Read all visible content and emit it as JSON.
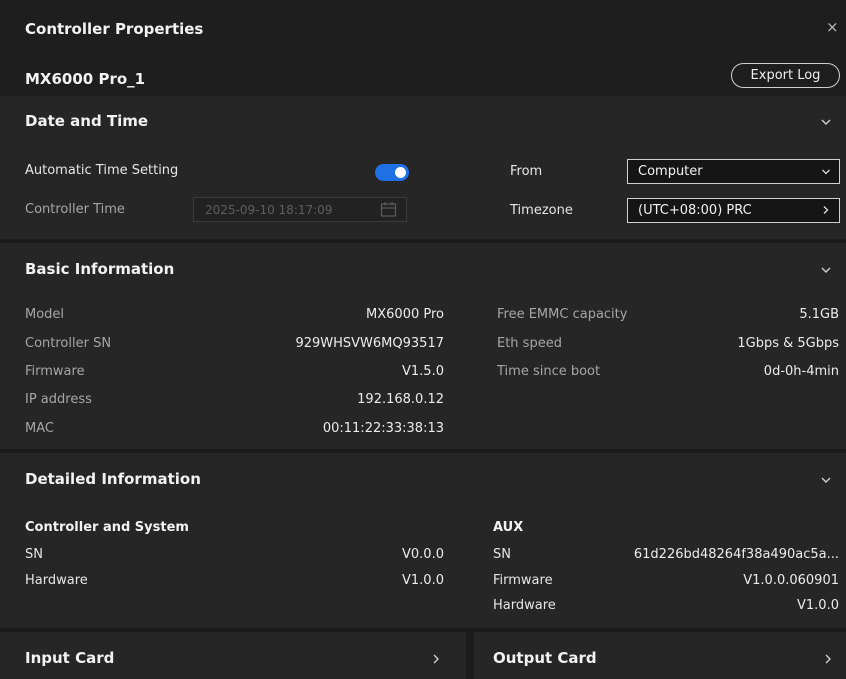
{
  "window": {
    "title": "Controller Properties",
    "close_label": "×"
  },
  "controller": {
    "name": "MX6000 Pro_1",
    "export_label": "Export Log"
  },
  "date_time": {
    "title": "Date and Time",
    "auto_label": "Automatic Time Setting",
    "auto_enabled": true,
    "time_label": "Controller Time",
    "time_value": "2025-09-10 18:17:09",
    "from_label": "From",
    "from_value": "Computer",
    "timezone_label": "Timezone",
    "timezone_value": "(UTC+08:00) PRC"
  },
  "basic": {
    "title": "Basic Information",
    "left": [
      {
        "label": "Model",
        "value": "MX6000 Pro"
      },
      {
        "label": "Controller SN",
        "value": "929WHSVW6MQ93517"
      },
      {
        "label": "Firmware",
        "value": "V1.5.0"
      },
      {
        "label": "IP address",
        "value": "192.168.0.12"
      },
      {
        "label": "MAC",
        "value": "00:11:22:33:38:13"
      }
    ],
    "right": [
      {
        "label": "Free EMMC capacity",
        "value": "5.1GB"
      },
      {
        "label": "Eth speed",
        "value": "1Gbps & 5Gbps"
      },
      {
        "label": "Time since boot",
        "value": "0d-0h-4min"
      }
    ]
  },
  "detailed": {
    "title": "Detailed Information",
    "left_title": "Controller and System",
    "left": [
      {
        "label": "SN",
        "value": "V0.0.0"
      },
      {
        "label": "Hardware",
        "value": "V1.0.0"
      }
    ],
    "right_title": "AUX",
    "right": [
      {
        "label": "SN",
        "value": "61d226bd48264f38a490ac5a..."
      },
      {
        "label": "Firmware",
        "value": "V1.0.0.060901"
      },
      {
        "label": "Hardware",
        "value": "V1.0.0"
      }
    ]
  },
  "cards": {
    "input_label": "Input Card",
    "output_label": "Output Card"
  },
  "colors": {
    "accent": "#1f6fe5",
    "panel": "#262626",
    "background": "#1b1b1b"
  }
}
